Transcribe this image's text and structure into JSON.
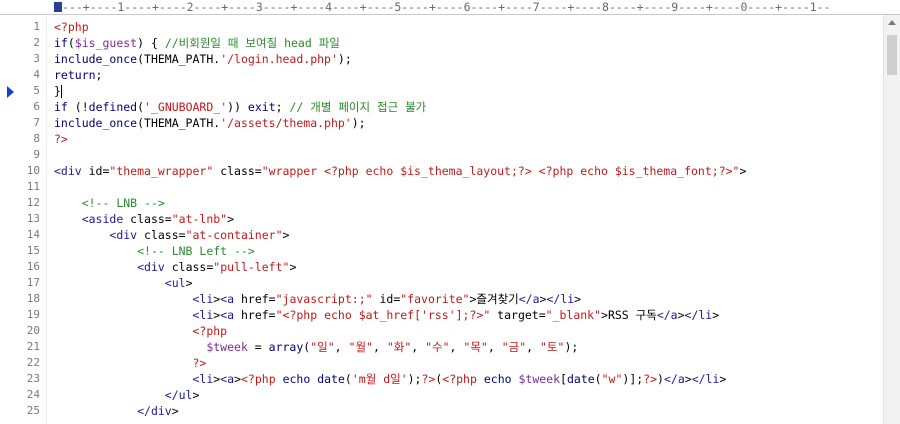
{
  "ruler": {
    "text": "---+----1----+----2----+----3----+----4----+----5----+----6----+----7----+----8----+----9----+----0----+----1--"
  },
  "lines": [
    {
      "n": "1",
      "t": "<?php"
    },
    {
      "n": "2",
      "t": "if($is_guest) { //비회원일 때 보여질 head 파일"
    },
    {
      "n": "3",
      "t": "include_once(THEMA_PATH.'/login.head.php');"
    },
    {
      "n": "4",
      "t": "return;"
    },
    {
      "n": "5",
      "t": "}"
    },
    {
      "n": "6",
      "t": "if (!defined('_GNUBOARD_')) exit; // 개별 페이지 접근 불가"
    },
    {
      "n": "7",
      "t": "include_once(THEMA_PATH.'/assets/thema.php');"
    },
    {
      "n": "8",
      "t": "?>"
    },
    {
      "n": "9",
      "t": ""
    },
    {
      "n": "10",
      "t": "<div id=\"thema_wrapper\" class=\"wrapper <?php echo $is_thema_layout;?> <?php echo $is_thema_font;?>\">"
    },
    {
      "n": "11",
      "t": ""
    },
    {
      "n": "12",
      "t": "    <!-- LNB -->"
    },
    {
      "n": "13",
      "t": "    <aside class=\"at-lnb\">"
    },
    {
      "n": "14",
      "t": "        <div class=\"at-container\">"
    },
    {
      "n": "15",
      "t": "            <!-- LNB Left -->"
    },
    {
      "n": "16",
      "t": "            <div class=\"pull-left\">"
    },
    {
      "n": "17",
      "t": "                <ul>"
    },
    {
      "n": "18",
      "t": "                    <li><a href=\"javascript:;\" id=\"favorite\">즐겨찾기</a></li>"
    },
    {
      "n": "19",
      "t": "                    <li><a href=\"<?php echo $at_href['rss'];?>\" target=\"_blank\">RSS 구독</a></li>"
    },
    {
      "n": "20",
      "t": "                    <?php"
    },
    {
      "n": "21",
      "t": "                      $tweek = array(\"일\", \"월\", \"화\", \"수\", \"목\", \"금\", \"토\");"
    },
    {
      "n": "22",
      "t": "                    ?>"
    },
    {
      "n": "23",
      "t": "                    <li><a><?php echo date('m월 d일');?>(<?php echo $tweek[date(\"w\")];?>)</a></li>"
    },
    {
      "n": "24",
      "t": "                </ul>"
    },
    {
      "n": "25",
      "t": "            </div>"
    }
  ],
  "colors": {
    "php_keyword": "#000080",
    "string": "#c21818",
    "variable": "#7a2a9a",
    "comment": "#2a8a2a",
    "html_tag": "#1a1a9a",
    "bookmark": "#1f3bd6"
  }
}
